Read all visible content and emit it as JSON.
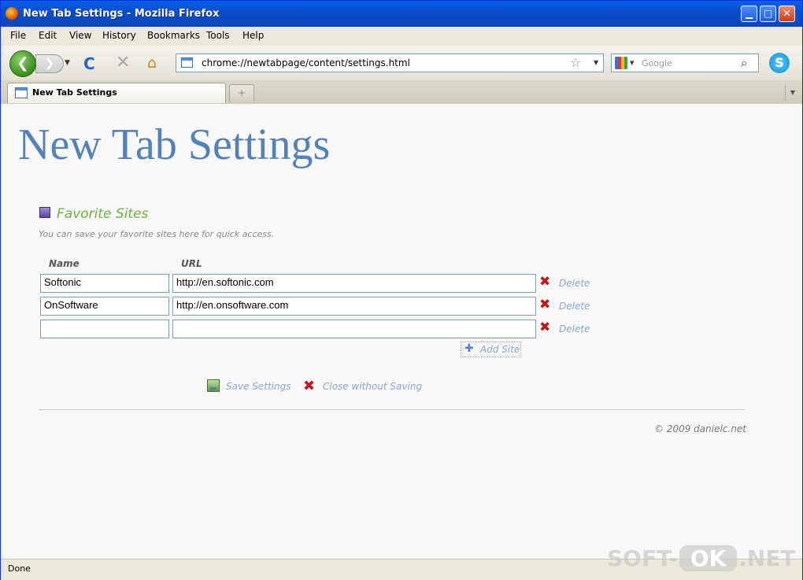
{
  "window": {
    "title": "New Tab Settings - Mozilla Firefox",
    "min_glyph": "▁",
    "max_glyph": "□",
    "close_glyph": "✕"
  },
  "menu": [
    "File",
    "Edit",
    "View",
    "History",
    "Bookmarks",
    "Tools",
    "Help"
  ],
  "navbar": {
    "back_glyph": "❮",
    "forward_glyph": "❯",
    "dropdown_glyph": "▼",
    "reload_glyph": "C",
    "stop_glyph": "✕",
    "home_glyph": "⌂",
    "url": "chrome://newtabpage/content/settings.html",
    "star_glyph": "☆",
    "search_placeholder": "Google",
    "search_glyph": "⌕",
    "skype_glyph": "S"
  },
  "tabs": [
    {
      "label": "New Tab Settings",
      "active": true
    }
  ],
  "tabbar": {
    "newtab_glyph": "+",
    "alltabs_glyph": "▼"
  },
  "page": {
    "title": "New Tab Settings",
    "section_title": "Favorite Sites",
    "section_subtitle": "You can save your favorite sites here for quick access.",
    "col_name": "Name",
    "col_url": "URL",
    "rows": [
      {
        "name": "Softonic",
        "url": "http://en.softonic.com",
        "delete_label": "Delete"
      },
      {
        "name": "OnSoftware",
        "url": "http://en.onsoftware.com",
        "delete_label": "Delete"
      },
      {
        "name": "",
        "url": "",
        "delete_label": "Delete"
      }
    ],
    "delete_glyph": "✖",
    "add_glyph": "✚",
    "add_site_label": "Add Site",
    "save_label": "Save Settings",
    "close_label": "Close without Saving",
    "footer": "© 2009 danielc.net"
  },
  "status": {
    "text": "Done"
  },
  "watermark": {
    "left": "SOFT-",
    "mid": "OK",
    "right": ".NET"
  },
  "colors": {
    "title_blue": "#5381b8",
    "section_green": "#6cb23d",
    "link_blue": "#8aa6cf",
    "delete_red": "#c01818"
  }
}
